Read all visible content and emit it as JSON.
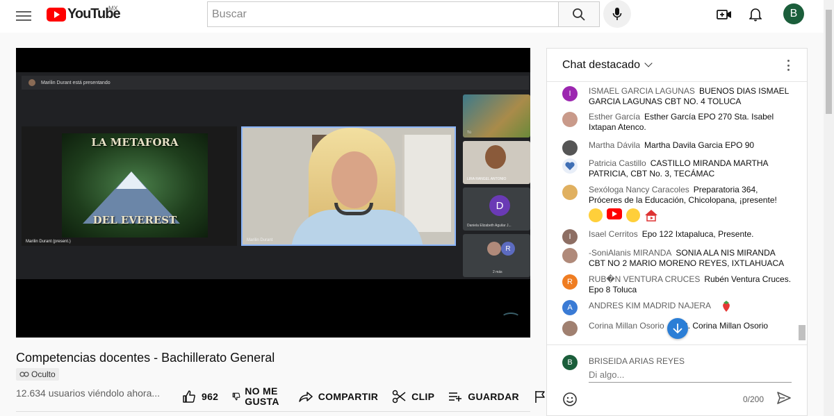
{
  "header": {
    "logo_text": "YouTube",
    "country": "MX",
    "search_placeholder": "Buscar",
    "avatar_letter": "B"
  },
  "video": {
    "meet_bar_text": "Marilin Durant está presentando",
    "slide_title_top": "LA METAFORA",
    "slide_title_bottom": "DEL EVEREST",
    "main_tile_label": "Marilin Durant (present.)",
    "presenter_label": "Marilin Durant",
    "side_tiles": [
      {
        "label": "Tú"
      },
      {
        "label": "LIRA RANGEL ANTONIO"
      },
      {
        "label": "Daniela Elizabeth Aguilar J...",
        "avatar": "D"
      },
      {
        "label": "2 más",
        "avatar": "R"
      }
    ]
  },
  "title": "Competencias docentes - Bachillerato General",
  "privacy_badge": "Oculto",
  "viewers": "12.634 usuarios viéndolo ahora...",
  "actions": {
    "likes": "962",
    "dislike_line1": "NO ME",
    "dislike_line2": "GUSTA",
    "share": "COMPARTIR",
    "clip": "CLIP",
    "save": "GUARDAR"
  },
  "chat": {
    "header": "Chat destacado",
    "messages": [
      {
        "author": "ISMAEL GARCIA LAGUNAS",
        "text": "BUENOS DIAS ISMAEL GARCIA LAGUNAS CBT NO. 4 TOLUCA",
        "avatar": "I",
        "color": "#9c27b0"
      },
      {
        "author": "Esther García",
        "text": "Esther García EPO 270 Sta. Isabel Ixtapan Atenco.",
        "avatar": "",
        "color": "#c99a8a"
      },
      {
        "author": "Martha Dávila",
        "text": "Martha Davila Garcia EPO 90",
        "avatar": "",
        "color": "#555555"
      },
      {
        "author": "Patricia Castillo",
        "text": "CASTILLO MIRANDA MARTHA PATRICIA, CBT No. 3, TECÁMAC",
        "avatar": "",
        "color": "#3f6fb5"
      },
      {
        "author": "Sexóloga Nancy Caracoles",
        "text": "Preparatoria 364, Próceres de la Educación, Chicolopana, ¡presente!",
        "avatar": "",
        "color": "#e0b060"
      },
      {
        "author": "Isael Cerritos",
        "text": "Epo 122 Ixtapaluca, Presente.",
        "avatar": "I",
        "color": "#8d6e63"
      },
      {
        "author": "-SoniAlanis MIRANDA",
        "text": "SONIA ALA NIS MIRANDA CBT NO 2 MARIO MORENO REYES, IXTLAHUACA",
        "avatar": "",
        "color": "#b08a7a"
      },
      {
        "author": "RUB�N VENTURA CRUCES",
        "text": "Rubén Ventura Cruces. Epo 8 Toluca",
        "avatar": "R",
        "color": "#ef7d22"
      },
      {
        "author": "ANDRES KIM MADRID NAJERA",
        "text": "",
        "avatar": "A",
        "color": "#3a7bd5"
      },
      {
        "author": "Corina Millan Osorio",
        "text": "ANIS. Corina Millan Osorio",
        "avatar": "",
        "color": "#a08070"
      }
    ],
    "me_avatar": "B",
    "me_name": "BRISEIDA ARIAS REYES",
    "input_placeholder": "Di algo...",
    "counter": "0/200"
  },
  "colors": {
    "youtube_red": "#ff0000",
    "avatar_green": "#1b5e3b",
    "scroll_button_blue": "#2b7ed6"
  }
}
